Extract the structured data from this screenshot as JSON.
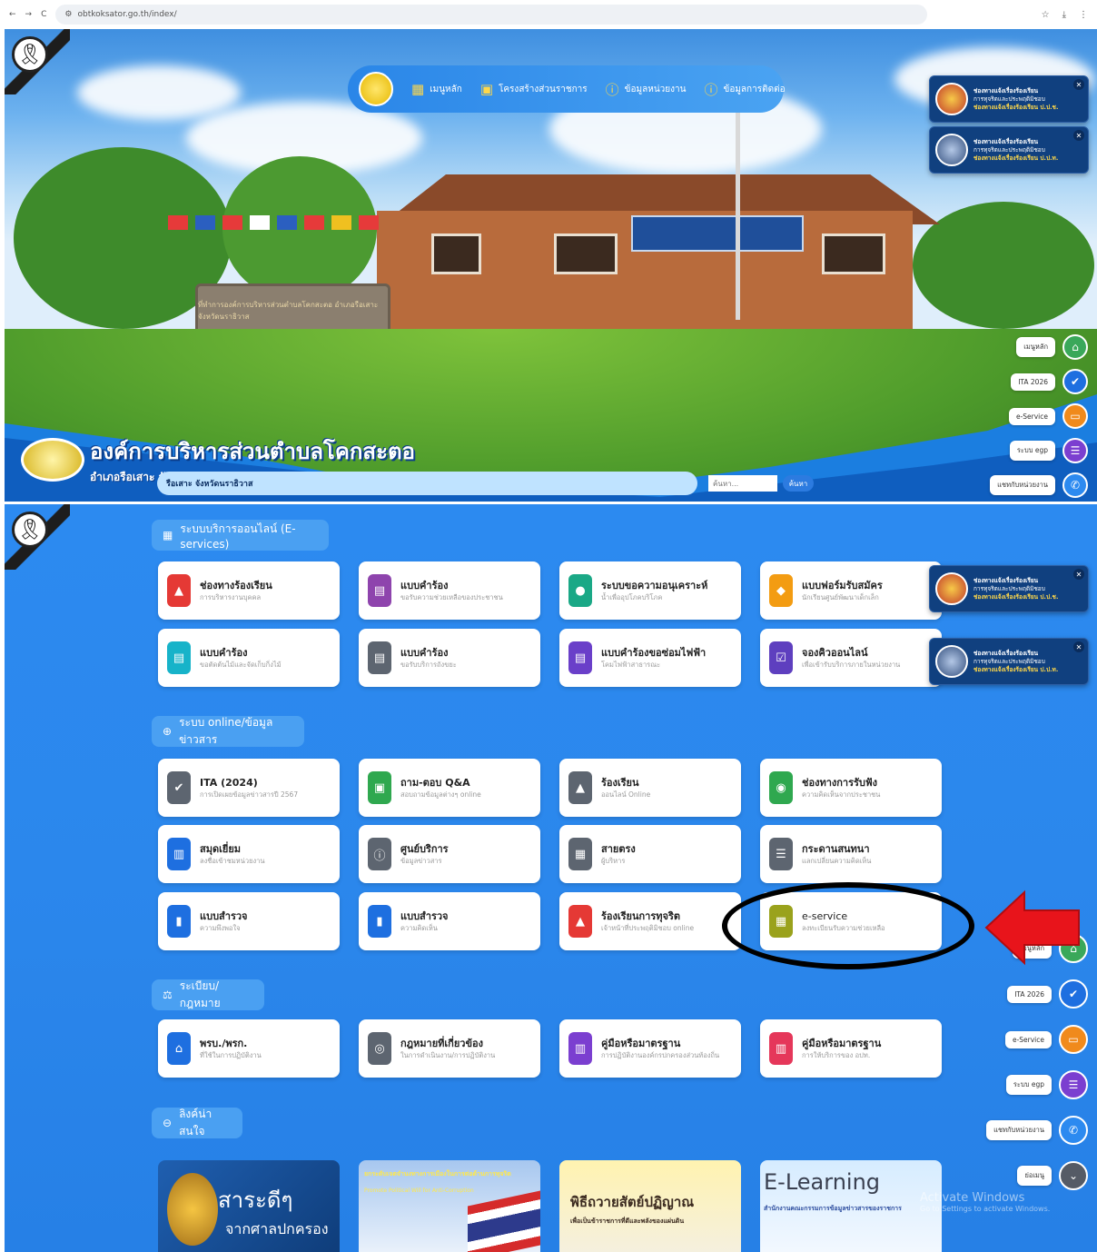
{
  "browser": {
    "url": "obtkoksator.go.th/index/",
    "nav_back": "←",
    "nav_forward": "→",
    "nav_reload": "C"
  },
  "topnav": {
    "items": [
      {
        "label": "เมนูหลัก",
        "icon": "grid-icon"
      },
      {
        "label": "โครงสร้างส่วนราชการ",
        "icon": "calendar-icon"
      },
      {
        "label": "ข้อมูลหน่วยงาน",
        "icon": "info-icon"
      },
      {
        "label": "ข้อมูลการติดต่อ",
        "icon": "info-icon"
      }
    ]
  },
  "org": {
    "name": "องค์การบริหารส่วนตำบลโคกสะตอ",
    "subtitle": "อำเภอรือเสาะ จังหวัดนราธิวาส"
  },
  "hero_sign": "ที่ทำการองค์การบริหารส่วนตำบลโคกสะตอ อำเภอรือเสาะ จังหวัดนราธิวาส",
  "marquee": {
    "text": "รือเสาะ จังหวัดนราธิวาส",
    "search_placeholder": "ค้นหา...",
    "search_button": "ค้นหา"
  },
  "notifications": [
    {
      "title": "ช่องทางแจ้งเรื่องร้องเรียน",
      "line2": "การทุจริตและประพฤติมิชอบ",
      "line3": "ช่องทางแจ้งเรื่องร้องเรียน ป.ป.ช."
    },
    {
      "title": "ช่องทางแจ้งเรื่องร้องเรียน",
      "line2": "การทุจริตและประพฤติมิชอบ",
      "line3": "ช่องทางแจ้งเรื่องร้องเรียน ป.ป.ท."
    }
  ],
  "quick_menu": [
    {
      "label": "เมนูหลัก",
      "color": "#3aa85a",
      "icon": "home-icon"
    },
    {
      "label": "ITA 2026",
      "color": "#1e6fe0",
      "icon": "check-badge-icon"
    },
    {
      "label": "e-Service",
      "color": "#f08a1c",
      "icon": "monitor-icon"
    },
    {
      "label": "ระบบ egp",
      "color": "#7b3fd0",
      "icon": "list-icon"
    },
    {
      "label": "แชทกับหน่วยงาน",
      "color": "#2c8af0",
      "icon": "messenger-icon"
    },
    {
      "label": "ย่อเมนู",
      "color": "#555b66",
      "icon": "chevron-down-icon"
    }
  ],
  "sections": {
    "eservices": "ระบบบริการออนไลน์ (E-services)",
    "online": "ระบบ online/ข้อมูลข่าวสาร",
    "law": "ระเบียบ/กฎหมาย",
    "links": "ลิงค์น่าสนใจ"
  },
  "eservice_cards": [
    {
      "title": "ช่องทางร้องเรียน",
      "sub": "การบริหารงานบุคคล",
      "color": "#e53935",
      "icon": "alert-icon"
    },
    {
      "title": "แบบคำร้อง",
      "sub": "ขอรับความช่วยเหลือของประชาชน",
      "color": "#8e44ad",
      "icon": "document-icon"
    },
    {
      "title": "ระบบขอความอนุเคราะห์",
      "sub": "น้ำเพื่ออุปโภคบริโภค",
      "color": "#1aa886",
      "icon": "water-drop-icon"
    },
    {
      "title": "แบบฟอร์มรับสมัคร",
      "sub": "นักเรียนศูนย์พัฒนาเด็กเล็ก",
      "color": "#f39c12",
      "icon": "graduation-icon"
    },
    {
      "title": "แบบคำร้อง",
      "sub": "ขอตัดต้นไม้และจัดเก็บกิ่งไม้",
      "color": "#17b3c9",
      "icon": "document-icon"
    },
    {
      "title": "แบบคำร้อง",
      "sub": "ขอรับบริการถังขยะ",
      "color": "#5d6570",
      "icon": "document-icon"
    },
    {
      "title": "แบบคำร้องขอซ่อมไฟฟ้า",
      "sub": "โคมไฟฟ้าสาธารณะ",
      "color": "#6a3fc9",
      "icon": "document-icon"
    },
    {
      "title": "จองคิวออนไลน์",
      "sub": "เพื่อเข้ารับบริการภายในหน่วยงาน",
      "color": "#5e3fbf",
      "icon": "calendar-check-icon"
    }
  ],
  "online_cards": [
    {
      "title": "ITA (2024)",
      "sub": "การเปิดเผยข้อมูลข่าวสารปี 2567",
      "color": "#5d6570",
      "icon": "check-badge-icon"
    },
    {
      "title": "ถาม-ตอบ Q&A",
      "sub": "สอบถามข้อมูลต่างๆ online",
      "color": "#2fa84f",
      "icon": "chat-icon"
    },
    {
      "title": "ร้องเรียน",
      "sub": "ออนไลน์ Online",
      "color": "#5d6570",
      "icon": "alert-icon"
    },
    {
      "title": "ช่องทางการรับฟัง",
      "sub": "ความคิดเห็นจากประชาชน",
      "color": "#2fa84f",
      "icon": "ear-icon"
    },
    {
      "title": "สมุดเยี่ยม",
      "sub": "ลงชื่อเข้าชมหน่วยงาน",
      "color": "#1e6fe0",
      "icon": "book-icon"
    },
    {
      "title": "ศูนย์บริการ",
      "sub": "ข้อมูลข่าวสาร",
      "color": "#5d6570",
      "icon": "info-icon"
    },
    {
      "title": "สายตรง",
      "sub": "ผู้บริหาร",
      "color": "#5d6570",
      "icon": "id-card-icon"
    },
    {
      "title": "กระดานสนทนา",
      "sub": "แลกเปลี่ยนความคิดเห็น",
      "color": "#5d6570",
      "icon": "forum-icon"
    },
    {
      "title": "แบบสำรวจ",
      "sub": "ความพึงพอใจ",
      "color": "#1e6fe0",
      "icon": "bar-chart-icon"
    },
    {
      "title": "แบบสำรวจ",
      "sub": "ความคิดเห็น",
      "color": "#1e6fe0",
      "icon": "bar-chart-icon"
    },
    {
      "title": "ร้องเรียนการทุจริต",
      "sub": "เจ้าหน้าที่ประพฤติมิชอบ online",
      "color": "#e53935",
      "icon": "alert-icon"
    },
    {
      "title": "e-service",
      "sub": "ลงทะเบียนรับความช่วยเหลือ",
      "color": "#9aa21c",
      "icon": "grid-icon"
    }
  ],
  "law_cards": [
    {
      "title": "พรบ./พรก.",
      "sub": "ที่ใช้ในการปฏิบัติงาน",
      "color": "#1e6fe0",
      "icon": "building-icon"
    },
    {
      "title": "กฎหมายที่เกี่ยวข้อง",
      "sub": "ในการดำเนินงาน/การปฏิบัติงาน",
      "color": "#5d6570",
      "icon": "search-doc-icon"
    },
    {
      "title": "คู่มือหรือมาตรฐาน",
      "sub": "การปฏิบัติงานองค์กรปกครองส่วนท้องถิ่น",
      "color": "#7b3fd0",
      "icon": "manual-icon"
    },
    {
      "title": "คู่มือหรือมาตรฐาน",
      "sub": "การให้บริการของ อปท.",
      "color": "#e5375a",
      "icon": "manual-icon"
    }
  ],
  "link_banners": [
    {
      "l1": "สาระดีๆ",
      "l2": "จากศาลปกครอง"
    },
    {
      "l1": "ยกระดับเจตจำนงทางการเมืองในการต่อต้านการทุจริต",
      "l2": "Promote Political Will for Anti-Corruption"
    },
    {
      "l1": "พิธีถวายสัตย์ปฏิญาณ",
      "l2": "เพื่อเป็นข้าราชการที่ดีและพลังของแผ่นดิน"
    },
    {
      "l1": "E-Learning",
      "l2": "สำนักงานคณะกรรมการข้อมูลข่าวสารของราชการ"
    }
  ],
  "watermark": {
    "line1": "Activate Windows",
    "line2": "Go to Settings to activate Windows."
  },
  "annotation": {
    "circle_color": "#000000",
    "arrow_color": "#e8141b"
  }
}
